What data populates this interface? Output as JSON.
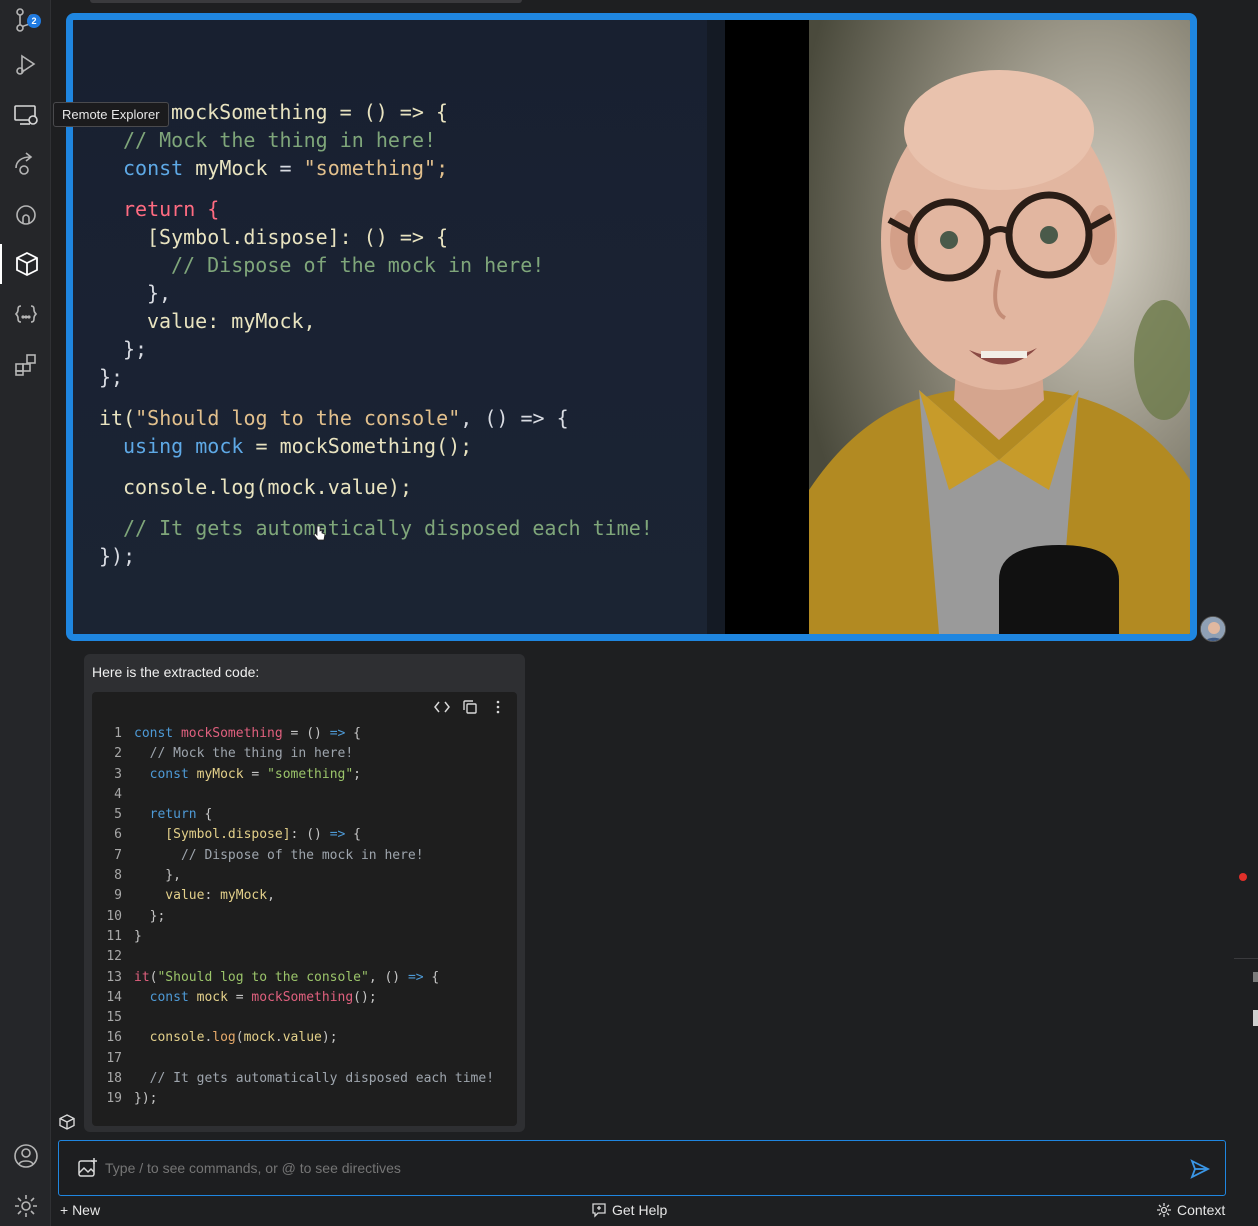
{
  "activity_bar": {
    "source_control_badge": "2",
    "tooltip": "Remote Explorer",
    "icons": [
      "source-control-icon",
      "run-debug-icon",
      "remote-explorer-icon",
      "live-share-icon",
      "github-icon",
      "cody-cube-icon",
      "json-braces-icon",
      "extensions-icon",
      "account-icon",
      "settings-gear-icon"
    ]
  },
  "video_code": {
    "line1_tail": "mockSomething = () => {",
    "line2": "// Mock the thing in here!",
    "line3_kw": "const",
    "line3_name": "myMock",
    "line3_str": "\"something\";",
    "line4": "return {",
    "line5": "[Symbol.dispose]: () => {",
    "line6": "// Dispose of the mock in here!",
    "line7": "},",
    "line8": "value: myMock,",
    "line9": "};",
    "line10": "};",
    "line11_fn": "it(",
    "line11_str": "\"Should log to the console\"",
    "line11_tail": ", () => {",
    "line12_kw": "using",
    "line12_name": "mock",
    "line12_tail": "= mockSomething();",
    "line13": "console.log(mock.value);",
    "line14": "// It gets automatically disposed each time!",
    "line15": "});"
  },
  "response": {
    "intro": "Here is the extracted code:",
    "code_lines": [
      {
        "n": "1",
        "parts": [
          [
            "ck",
            "const "
          ],
          [
            "cr",
            "mockSomething"
          ],
          [
            "cp",
            " = () "
          ],
          [
            "ck",
            "=>"
          ],
          [
            "cp",
            " {"
          ]
        ]
      },
      {
        "n": "2",
        "parts": [
          [
            "cc",
            "  // Mock the thing in here!"
          ]
        ]
      },
      {
        "n": "3",
        "parts": [
          [
            "ck",
            "  const "
          ],
          [
            "cv",
            "myMock"
          ],
          [
            "cp",
            " = "
          ],
          [
            "cs",
            "\"something\""
          ],
          [
            "cp",
            ";"
          ]
        ]
      },
      {
        "n": "4",
        "parts": []
      },
      {
        "n": "5",
        "parts": [
          [
            "ck",
            "  return "
          ],
          [
            "cp",
            "{"
          ]
        ]
      },
      {
        "n": "6",
        "parts": [
          [
            "cv",
            "    [Symbol.dispose]"
          ],
          [
            "cp",
            ": () "
          ],
          [
            "ck",
            "=>"
          ],
          [
            "cp",
            " {"
          ]
        ]
      },
      {
        "n": "7",
        "parts": [
          [
            "cc",
            "      // Dispose of the mock in here!"
          ]
        ]
      },
      {
        "n": "8",
        "parts": [
          [
            "cp",
            "    },"
          ]
        ]
      },
      {
        "n": "9",
        "parts": [
          [
            "cv",
            "    value"
          ],
          [
            "cp",
            ": "
          ],
          [
            "cv",
            "myMock"
          ],
          [
            "cp",
            ","
          ]
        ]
      },
      {
        "n": "10",
        "parts": [
          [
            "cp",
            "  };"
          ]
        ]
      },
      {
        "n": "11",
        "parts": [
          [
            "cp",
            "}"
          ]
        ]
      },
      {
        "n": "12",
        "parts": []
      },
      {
        "n": "13",
        "parts": [
          [
            "cr",
            "it"
          ],
          [
            "cp",
            "("
          ],
          [
            "cs",
            "\"Should log to the console\""
          ],
          [
            "cp",
            ", () "
          ],
          [
            "ck",
            "=>"
          ],
          [
            "cp",
            " {"
          ]
        ]
      },
      {
        "n": "14",
        "parts": [
          [
            "ck",
            "  const "
          ],
          [
            "cv",
            "mock"
          ],
          [
            "cp",
            " = "
          ],
          [
            "cr",
            "mockSomething"
          ],
          [
            "cp",
            "();"
          ]
        ]
      },
      {
        "n": "15",
        "parts": []
      },
      {
        "n": "16",
        "parts": [
          [
            "cv",
            "  console"
          ],
          [
            "cp",
            "."
          ],
          [
            "cf",
            "log"
          ],
          [
            "cp",
            "("
          ],
          [
            "cv",
            "mock"
          ],
          [
            "cp",
            "."
          ],
          [
            "cv",
            "value"
          ],
          [
            "cp",
            ");"
          ]
        ]
      },
      {
        "n": "17",
        "parts": []
      },
      {
        "n": "18",
        "parts": [
          [
            "cc",
            "  // It gets automatically disposed each time!"
          ]
        ]
      },
      {
        "n": "19",
        "parts": [
          [
            "cp",
            "});"
          ]
        ]
      }
    ]
  },
  "input": {
    "placeholder": "Type / to see commands, or @ to see directives"
  },
  "footer": {
    "new_label": "+ New",
    "help_label": "Get Help",
    "context_label": "Context"
  },
  "colors": {
    "accent": "#1f86e0",
    "panel": "#2e2f32",
    "background": "#1e1f21"
  }
}
